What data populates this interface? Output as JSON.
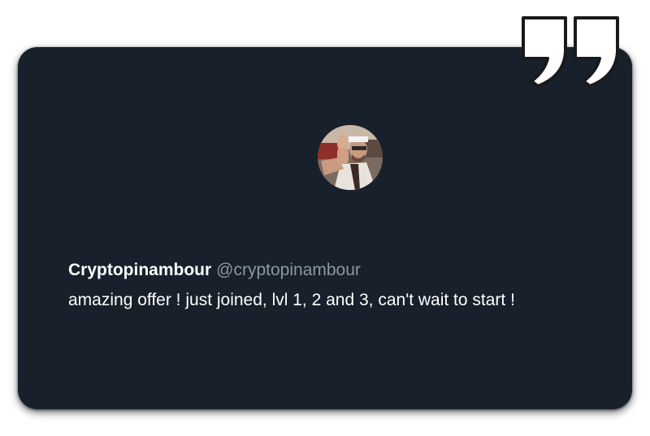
{
  "tweet": {
    "display_name": "Cryptopinambour",
    "handle": "@cryptopinambour",
    "text": "amazing offer ! just joined, lvl 1, 2 and 3, can't wait to start !"
  },
  "icons": {
    "quote": "closing-quote-icon",
    "avatar": "user-avatar"
  },
  "colors": {
    "card_background": "#17202b",
    "text_primary": "#ffffff",
    "text_secondary": "#8b98a5",
    "quote_mark": "#ffffff"
  }
}
